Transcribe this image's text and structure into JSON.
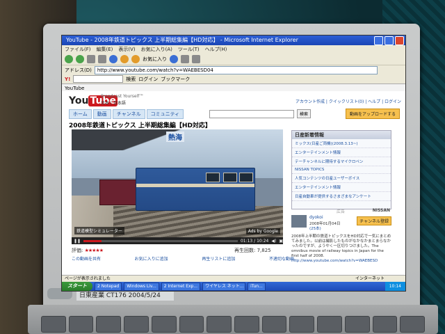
{
  "browser": {
    "title": "YouTube - 2008年鉄道トピックス 上半期総集編【HD対応】 - Microsoft Internet Explorer",
    "menu": [
      "ファイル(F)",
      "編集(E)",
      "表示(V)",
      "お気に入り(A)",
      "ツール(T)",
      "ヘルプ(H)"
    ],
    "favorites_label": "お気に入り",
    "address_label": "アドレス(D)",
    "address": "http://www.youtube.com/watch?v=WAEBESD04",
    "search_button": "検索",
    "login_label": "ログイン",
    "tab": "YouTube",
    "bookmark_label": "ブックマーク"
  },
  "youtube": {
    "logo_you": "You",
    "logo_tube": "Tube",
    "tagline": "Broadcast Yourself™",
    "lang": "日本 | 日本語",
    "account_links": "アカウント作成 | クイックリスト(0) | ヘルプ | ログイン",
    "nav": [
      "ホーム",
      "動画",
      "チャンネル",
      "コミュニティ"
    ],
    "search_btn": "検索",
    "upload_btn": "動画をアップロードする",
    "video_title": "2008年鉄道トピックス 上半期総集編【HD対応】",
    "station_sign": "熱海",
    "caption_left": "鉄道模型シミュレーター",
    "caption_right": "Ads by Google",
    "time": "01:13 / 10:24",
    "rating_label": "評価:",
    "stars": "★★★★★",
    "views_label": "再生回数:",
    "views": "7,825",
    "actions": [
      "この動画を共有",
      "お気に入りに追加",
      "再生リストに追加",
      "不適切な動画"
    ],
    "news_title": "日産新着情報",
    "news_items": [
      "ミックス(日産ご両機)(2008.3.13~)",
      "エンターテインメント情報",
      "テーチャンネルに期待するマイクロペン",
      "NISSAN TOPICS",
      "人気コンテンツの日産ユーザーボイス",
      "エンターテインメント情報",
      "日産自動車が提供するさまざまなアンケート"
    ],
    "ad_label": "広告",
    "nissan": "NISSAN",
    "owner": "dyokoi",
    "owner_date": "2008年01月04日",
    "owner_videos": "(25本)",
    "subscribe": "チャンネル登録",
    "description": "2008年上半期の鉄道トピックスをHD対応で一気にまとめてみました。以前は撮影したものがなかなかまとまらなかったのですが、ようやく一区切りつけました。The omnibus movie of railway topics in Japan for the first half of 2008.",
    "desc_link": "http://www.youtube.com/watch?v=WAEBESD"
  },
  "status": {
    "left": "ページが表示されました",
    "right": "インターネット"
  },
  "taskbar": {
    "start": "スタート",
    "tasks": [
      "2 Notepad",
      "Windows Liv...",
      "2 Internet Exp...",
      "ワイヤレス ネット...",
      "iTun..."
    ],
    "clock": "10:14"
  },
  "laptop_sticker": "日東産業 CT176 2004/5/24"
}
